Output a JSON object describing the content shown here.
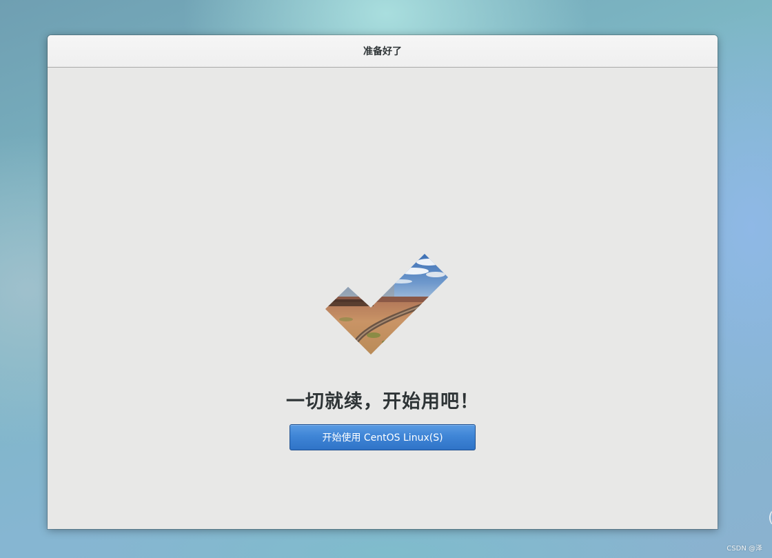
{
  "window": {
    "title": "准备好了"
  },
  "main": {
    "illustration_icon": "checkmark-landscape-icon",
    "headline": "一切就续，开始用吧！",
    "start_button_label": "开始使用  CentOS Linux(S)"
  },
  "overlay": {
    "watermark": "CSDN @泽",
    "edge_glyph": "("
  },
  "colors": {
    "accent": "#3f85d6",
    "dialog_bg": "#e8e8e7",
    "titlebar_bg": "#f4f4f4",
    "text": "#2e3436"
  }
}
